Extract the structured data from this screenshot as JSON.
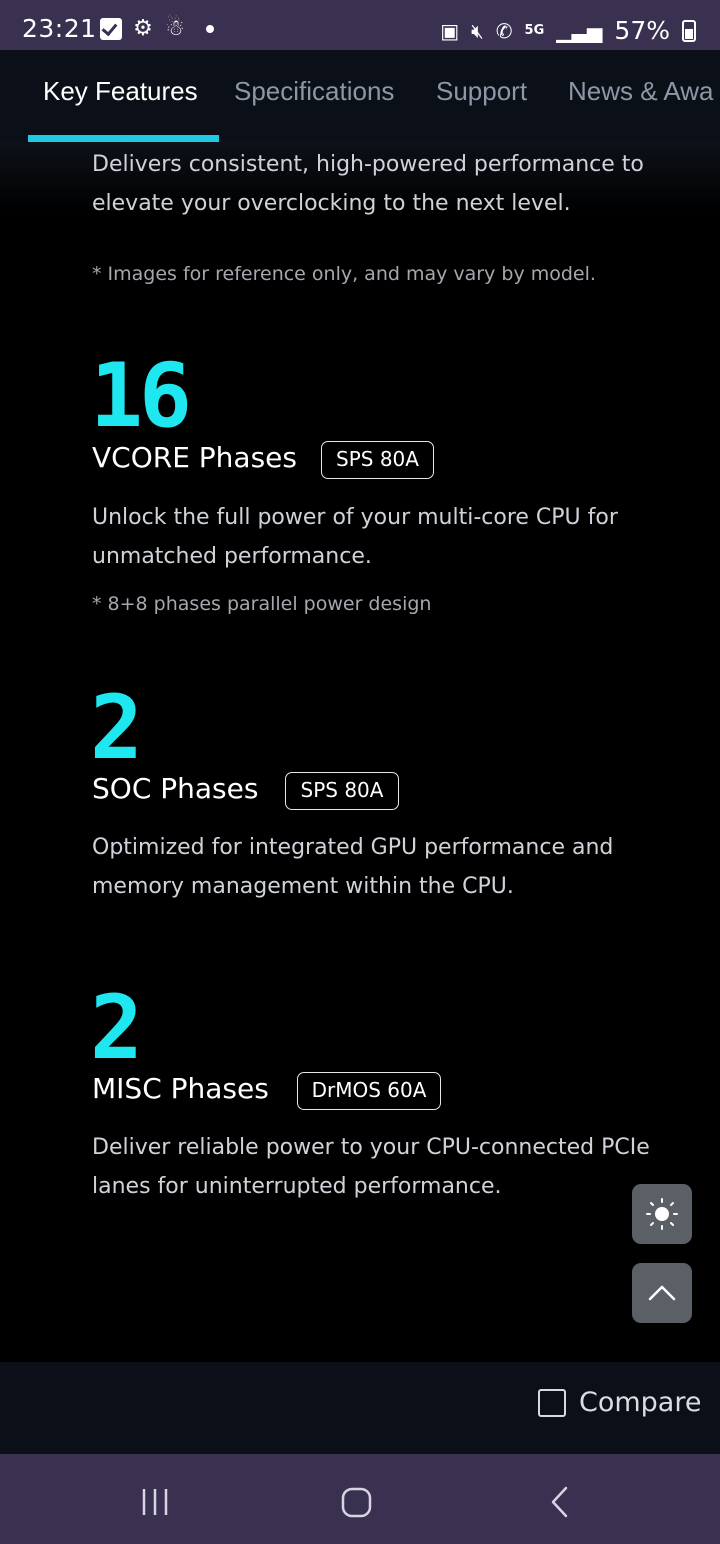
{
  "status_bar": {
    "time": "23:21",
    "network": "5G",
    "battery": "57%"
  },
  "tabs": [
    {
      "label": "Key Features",
      "active": true
    },
    {
      "label": "Specifications"
    },
    {
      "label": "Support"
    },
    {
      "label": "News & Awa"
    }
  ],
  "intro": {
    "text": "Delivers consistent, high-powered performance to elevate your overclocking to the next level.",
    "note": "* Images for reference only, and may vary by model."
  },
  "phases": [
    {
      "number": "16",
      "title": "VCORE Phases",
      "badge": "SPS 80A",
      "description": "Unlock the full power of your multi-core CPU for unmatched performance.",
      "note": "* 8+8 phases parallel power design"
    },
    {
      "number": "2",
      "title": "SOC Phases",
      "badge": "SPS 80A",
      "description": "Optimized for integrated GPU performance and memory management within the CPU."
    },
    {
      "number": "2",
      "title": "MISC Phases",
      "badge": "DrMOS 60A",
      "description": "Deliver reliable power to your CPU-connected PCIe lanes for uninterrupted performance."
    }
  ],
  "compare": {
    "label": "Compare"
  },
  "colors": {
    "accent": "#1fe7ef",
    "tab_underline": "#1fc8e3",
    "system_bar": "#3a3150"
  }
}
